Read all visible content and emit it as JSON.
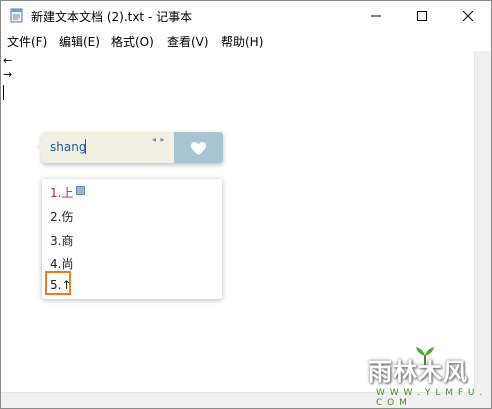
{
  "window": {
    "title": "新建文本文档 (2).txt - 记事本",
    "controls": [
      "minimize",
      "maximize",
      "close"
    ]
  },
  "menubar": {
    "items": [
      {
        "label": "文件(F)"
      },
      {
        "label": "编辑(E)"
      },
      {
        "label": "格式(O)"
      },
      {
        "label": "查看(V)"
      },
      {
        "label": "帮助(H)"
      }
    ]
  },
  "editor": {
    "lines": [
      "←",
      "→"
    ]
  },
  "ime": {
    "composition": "shang",
    "page_arrows": "◂ ▸",
    "icon": "heart-icon"
  },
  "candidates": {
    "items": [
      {
        "label": "1.上"
      },
      {
        "label": "2.伤"
      },
      {
        "label": "3.商"
      },
      {
        "label": "4.尚"
      },
      {
        "label": "5.↑"
      }
    ],
    "highlighted_index": 4,
    "highlight_color": "#f07c1e"
  },
  "watermark": {
    "text": "雨林木风",
    "url_text": "W W W . Y L M F U . C O M"
  }
}
